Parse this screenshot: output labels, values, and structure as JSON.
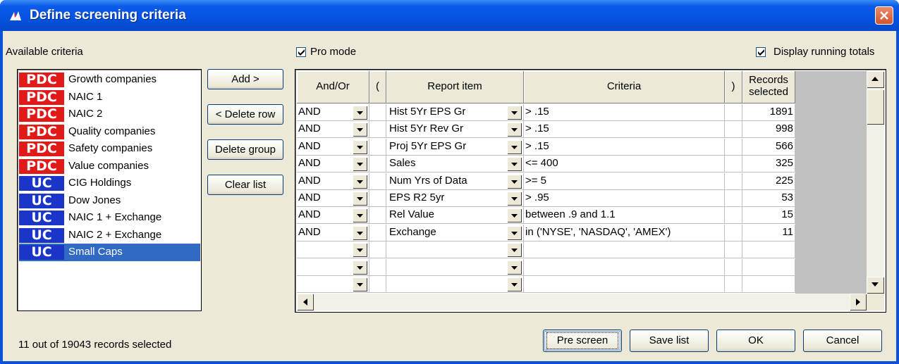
{
  "window": {
    "title": "Define screening criteria"
  },
  "available_criteria_label": "Available criteria",
  "pro_mode": {
    "label": "Pro mode",
    "checked": true
  },
  "running_totals": {
    "label": "Display running totals",
    "checked": true
  },
  "criteria_list": [
    {
      "badge": "PDC",
      "label": "Growth companies"
    },
    {
      "badge": "PDC",
      "label": "NAIC 1"
    },
    {
      "badge": "PDC",
      "label": "NAIC 2"
    },
    {
      "badge": "PDC",
      "label": "Quality companies"
    },
    {
      "badge": "PDC",
      "label": "Safety companies"
    },
    {
      "badge": "PDC",
      "label": "Value companies"
    },
    {
      "badge": "UC",
      "label": "CIG Holdings"
    },
    {
      "badge": "UC",
      "label": "Dow Jones"
    },
    {
      "badge": "UC",
      "label": "NAIC 1 + Exchange"
    },
    {
      "badge": "UC",
      "label": "NAIC 2 + Exchange"
    },
    {
      "badge": "UC",
      "label": "Small Caps",
      "selected": true
    }
  ],
  "buttons": {
    "add": "Add >",
    "delete_row": "< Delete row",
    "delete_group": "Delete group",
    "clear_list": "Clear list",
    "pre_screen": "Pre screen",
    "save_list": "Save list",
    "ok": "OK",
    "cancel": "Cancel"
  },
  "grid": {
    "headers": {
      "and_or": "And/Or",
      "open_paren": "(",
      "report_item": "Report item",
      "criteria": "Criteria",
      "close_paren": ")",
      "records_1": "Records",
      "records_2": "selected"
    },
    "rows": [
      {
        "and_or": "AND",
        "item": "Hist 5Yr EPS Gr",
        "criteria": "> .15",
        "records": "1891"
      },
      {
        "and_or": "AND",
        "item": "Hist 5Yr Rev Gr",
        "criteria": "> .15",
        "records": "998"
      },
      {
        "and_or": "AND",
        "item": "Proj 5Yr EPS Gr",
        "criteria": "> .15",
        "records": "566"
      },
      {
        "and_or": "AND",
        "item": "Sales",
        "criteria": "<= 400",
        "records": "325"
      },
      {
        "and_or": "AND",
        "item": "Num Yrs of Data",
        "criteria": ">= 5",
        "records": "225"
      },
      {
        "and_or": "AND",
        "item": "EPS R2 5yr",
        "criteria": "> .95",
        "records": "53"
      },
      {
        "and_or": "AND",
        "item": "Rel Value",
        "criteria": "between .9 and 1.1",
        "records": "15"
      },
      {
        "and_or": "AND",
        "item": "Exchange",
        "criteria": "in ('NYSE', 'NASDAQ', 'AMEX')",
        "records": "11"
      },
      {
        "and_or": "",
        "item": "",
        "criteria": "",
        "records": ""
      },
      {
        "and_or": "",
        "item": "",
        "criteria": "",
        "records": ""
      },
      {
        "and_or": "",
        "item": "",
        "criteria": "",
        "records": ""
      }
    ]
  },
  "status": "11 out of 19043 records selected",
  "colors": {
    "pdc_badge": "#e01919",
    "uc_badge": "#1a35c8",
    "selection": "#316ac5",
    "titlebar": "#0553df"
  }
}
